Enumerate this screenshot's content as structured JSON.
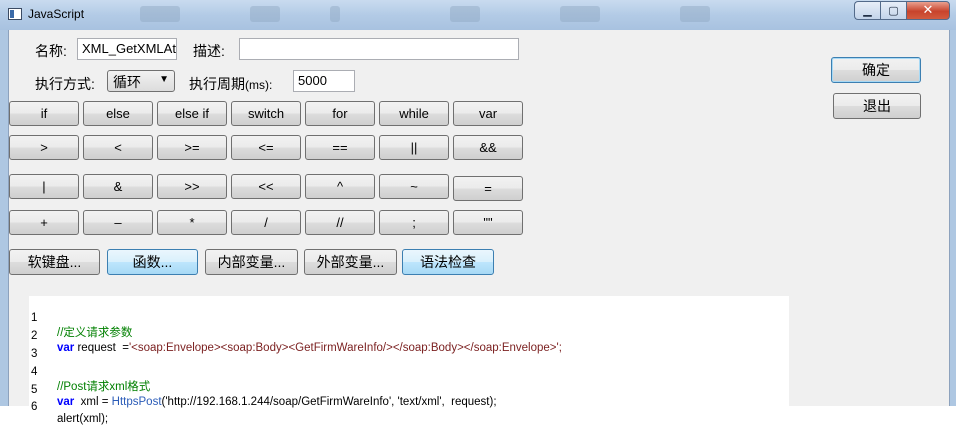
{
  "window": {
    "title": "JavaScript",
    "minimize_label": "▁",
    "maximize_label": "▢",
    "close_label": "✕"
  },
  "form": {
    "name_label": "名称:",
    "name_value": "XML_GetXMLAt",
    "desc_label": "描述:",
    "desc_value": "",
    "mode_label": "执行方式:",
    "mode_value": "循环",
    "period_label": "执行周期",
    "period_unit": "(ms):",
    "period_value": "5000"
  },
  "actions": {
    "ok": "确定",
    "exit": "退出"
  },
  "keypad": {
    "row1": [
      "if",
      "else",
      "else if",
      "switch",
      "for",
      "while",
      "var"
    ],
    "row2": [
      ">",
      "<",
      ">=",
      "<=",
      "==",
      "||",
      "&&"
    ],
    "row3": [
      "|",
      "&",
      ">>",
      "<<",
      "^",
      "~",
      "="
    ],
    "row4": [
      "+",
      "–",
      "*",
      "/",
      "//",
      ";",
      "\"\""
    ]
  },
  "tools": {
    "soft_keyboard": "软键盘...",
    "functions": "函数...",
    "internal_vars": "内部变量...",
    "external_vars": "外部变量...",
    "syntax_check": "语法检查"
  },
  "code": {
    "lines": [
      {
        "n": "1",
        "comment": "//定义请求参数"
      },
      {
        "n": "2",
        "kw": "var",
        "rest": " request  =",
        "str": "'<soap:Envelope><soap:Body><GetFirmWareInfo/></soap:Body></soap:Envelope>';"
      },
      {
        "n": "3"
      },
      {
        "n": "4",
        "comment": "//Post请求xml格式"
      },
      {
        "n": "5",
        "kw": "var",
        "rest": "  xml = ",
        "fn": "HttpsPost",
        "args": "('http://192.168.1.244/soap/GetFirmWareInfo', 'text/xml',  request);"
      },
      {
        "n": "6",
        "plain": "alert(xml);"
      }
    ]
  }
}
